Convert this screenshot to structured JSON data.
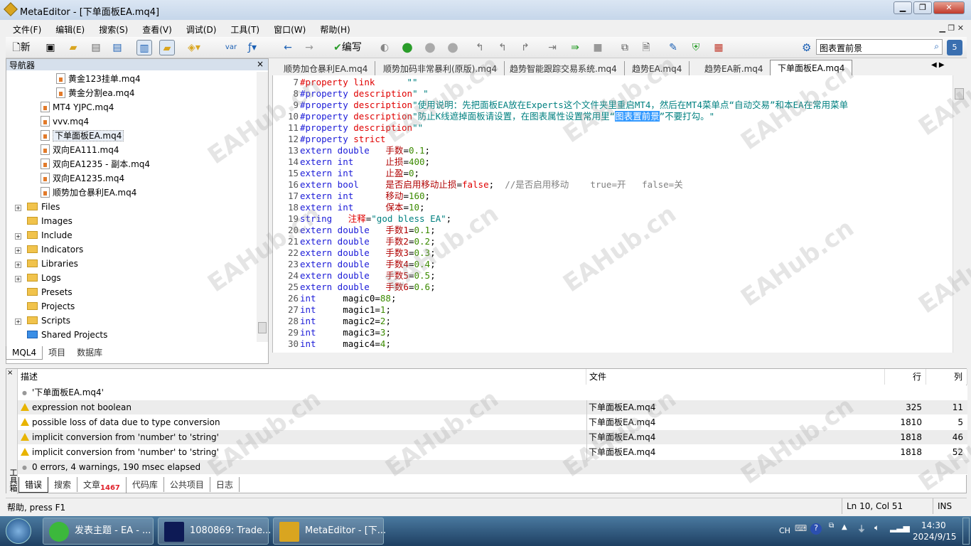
{
  "window": {
    "title": "MetaEditor - [下单面板EA.mq4]",
    "minimize": "▁",
    "restore": "❐",
    "close": "✕"
  },
  "menu": [
    "文件(F)",
    "编辑(E)",
    "搜索(S)",
    "查看(V)",
    "调试(D)",
    "工具(T)",
    "窗口(W)",
    "帮助(H)"
  ],
  "toolbar": {
    "new_label": "新",
    "compile_label": "编写",
    "var_label": "var",
    "search_value": "图表置前景"
  },
  "navigator": {
    "title": "导航器",
    "close": "×",
    "items": [
      {
        "label": "黄金123挂单.mq4",
        "type": "file",
        "indent": 3
      },
      {
        "label": "黄金分割ea.mq4",
        "type": "file",
        "indent": 3
      },
      {
        "label": "MT4 YJPC.mq4",
        "type": "file",
        "indent": 2
      },
      {
        "label": "vvv.mq4",
        "type": "file",
        "indent": 2
      },
      {
        "label": "下单面板EA.mq4",
        "type": "file",
        "indent": 2,
        "selected": true
      },
      {
        "label": "双向EA111.mq4",
        "type": "file",
        "indent": 2
      },
      {
        "label": "双向EA1235 - 副本.mq4",
        "type": "file",
        "indent": 2
      },
      {
        "label": "双向EA1235.mq4",
        "type": "file",
        "indent": 2
      },
      {
        "label": "顺势加仓暴利EA.mq4",
        "type": "file",
        "indent": 2
      },
      {
        "label": "Files",
        "type": "folder",
        "expand": true
      },
      {
        "label": "Images",
        "type": "folder",
        "expand": false
      },
      {
        "label": "Include",
        "type": "folder",
        "expand": true
      },
      {
        "label": "Indicators",
        "type": "folder",
        "expand": true
      },
      {
        "label": "Libraries",
        "type": "folder",
        "expand": true
      },
      {
        "label": "Logs",
        "type": "folder",
        "expand": true
      },
      {
        "label": "Presets",
        "type": "folder",
        "expand": false
      },
      {
        "label": "Projects",
        "type": "folder",
        "expand": false
      },
      {
        "label": "Scripts",
        "type": "folder",
        "expand": true
      },
      {
        "label": "Shared Projects",
        "type": "folder-blue",
        "expand": false
      }
    ],
    "tabs": [
      "MQL4",
      "项目",
      "数据库"
    ]
  },
  "file_tabs": [
    "顺势加仓暴利EA.mq4",
    "顺势加码非常暴利(原版).mq4",
    "趋势智能跟踪交易系统.mq4",
    "趋势EA.mq4",
    "趋势EA新.mq4",
    "下单面板EA.mq4"
  ],
  "active_file_tab": 5,
  "code": [
    {
      "n": "7",
      "t": [
        [
          "p",
          "#property "
        ],
        [
          "p",
          "link"
        ],
        [
          "s",
          "      \"\""
        ]
      ]
    },
    {
      "n": "8",
      "t": [
        [
          "k",
          "#property "
        ],
        [
          "p",
          "description"
        ],
        [
          "s",
          "\" \""
        ]
      ]
    },
    {
      "n": "9",
      "t": [
        [
          "k",
          "#property "
        ],
        [
          "p",
          "description"
        ],
        [
          "s",
          "\"使用说明：先把面板EA放在Experts这个文件夹里重启MT4，然后在MT4菜单点“自动交易”和本EA在常用菜单"
        ]
      ]
    },
    {
      "n": "10",
      "t": [
        [
          "k",
          "#property "
        ],
        [
          "p",
          "description"
        ],
        [
          "s",
          "\"防止K线遮掉面板请设置，在图表属性设置常用里“"
        ],
        [
          "sel",
          "图表置前景"
        ],
        [
          "s",
          "”不要打勾。\""
        ]
      ]
    },
    {
      "n": "11",
      "t": [
        [
          "k",
          "#property "
        ],
        [
          "p",
          "description"
        ],
        [
          "s",
          "\"\""
        ]
      ]
    },
    {
      "n": "12",
      "t": [
        [
          "k",
          "#property "
        ],
        [
          "p",
          "strict"
        ]
      ]
    },
    {
      "n": "13",
      "t": [
        [
          "k",
          "extern double   "
        ],
        [
          "v",
          "手数"
        ],
        [
          "o",
          "="
        ],
        [
          "n",
          "0.1"
        ],
        [
          "o",
          ";"
        ]
      ]
    },
    {
      "n": "14",
      "t": [
        [
          "k",
          "extern int      "
        ],
        [
          "v",
          "止损"
        ],
        [
          "o",
          "="
        ],
        [
          "n",
          "400"
        ],
        [
          "o",
          ";"
        ]
      ]
    },
    {
      "n": "15",
      "t": [
        [
          "k",
          "extern int      "
        ],
        [
          "v",
          "止盈"
        ],
        [
          "o",
          "="
        ],
        [
          "n",
          "0"
        ],
        [
          "o",
          ";"
        ]
      ]
    },
    {
      "n": "16",
      "t": [
        [
          "k",
          "extern bool     "
        ],
        [
          "v",
          "是否启用移动止损"
        ],
        [
          "o",
          "="
        ],
        [
          "f",
          "false"
        ],
        [
          "o",
          ";  "
        ],
        [
          "c",
          "//是否启用移动    true=开   false=关"
        ]
      ]
    },
    {
      "n": "17",
      "t": [
        [
          "k",
          "extern int      "
        ],
        [
          "v",
          "移动"
        ],
        [
          "o",
          "="
        ],
        [
          "n",
          "160"
        ],
        [
          "o",
          ";"
        ]
      ]
    },
    {
      "n": "18",
      "t": [
        [
          "k",
          "extern int      "
        ],
        [
          "v",
          "保本"
        ],
        [
          "o",
          "="
        ],
        [
          "n",
          "10"
        ],
        [
          "o",
          ";"
        ]
      ]
    },
    {
      "n": "19",
      "t": [
        [
          "k",
          "string   "
        ],
        [
          "p",
          "注释"
        ],
        [
          "o",
          "="
        ],
        [
          "s",
          "\"god bless EA\""
        ],
        [
          "o",
          ";"
        ]
      ]
    },
    {
      "n": "20",
      "t": [
        [
          "k",
          "extern double   "
        ],
        [
          "v",
          "手数1"
        ],
        [
          "o",
          "="
        ],
        [
          "n",
          "0.1"
        ],
        [
          "o",
          ";"
        ]
      ]
    },
    {
      "n": "21",
      "t": [
        [
          "k",
          "extern double   "
        ],
        [
          "v",
          "手数2"
        ],
        [
          "o",
          "="
        ],
        [
          "n",
          "0.2"
        ],
        [
          "o",
          ";"
        ]
      ]
    },
    {
      "n": "22",
      "t": [
        [
          "k",
          "extern double   "
        ],
        [
          "v",
          "手数3"
        ],
        [
          "o",
          "="
        ],
        [
          "n",
          "0.3"
        ],
        [
          "o",
          ";"
        ]
      ]
    },
    {
      "n": "23",
      "t": [
        [
          "k",
          "extern double   "
        ],
        [
          "v",
          "手数4"
        ],
        [
          "o",
          "="
        ],
        [
          "n",
          "0.4"
        ],
        [
          "o",
          ";"
        ]
      ]
    },
    {
      "n": "24",
      "t": [
        [
          "k",
          "extern double   "
        ],
        [
          "v",
          "手数5"
        ],
        [
          "o",
          "="
        ],
        [
          "n",
          "0.5"
        ],
        [
          "o",
          ";"
        ]
      ]
    },
    {
      "n": "25",
      "t": [
        [
          "k",
          "extern double   "
        ],
        [
          "v",
          "手数6"
        ],
        [
          "o",
          "="
        ],
        [
          "n",
          "0.6"
        ],
        [
          "o",
          ";"
        ]
      ]
    },
    {
      "n": "26",
      "t": [
        [
          "k",
          "int     "
        ],
        [
          "o",
          "magic0="
        ],
        [
          "n",
          "88"
        ],
        [
          "o",
          ";"
        ]
      ]
    },
    {
      "n": "27",
      "t": [
        [
          "k",
          "int     "
        ],
        [
          "o",
          "magic1="
        ],
        [
          "n",
          "1"
        ],
        [
          "o",
          ";"
        ]
      ]
    },
    {
      "n": "28",
      "t": [
        [
          "k",
          "int     "
        ],
        [
          "o",
          "magic2="
        ],
        [
          "n",
          "2"
        ],
        [
          "o",
          ";"
        ]
      ]
    },
    {
      "n": "29",
      "t": [
        [
          "k",
          "int     "
        ],
        [
          "o",
          "magic3="
        ],
        [
          "n",
          "3"
        ],
        [
          "o",
          ";"
        ]
      ]
    },
    {
      "n": "30",
      "t": [
        [
          "k",
          "int     "
        ],
        [
          "o",
          "magic4="
        ],
        [
          "n",
          "4"
        ],
        [
          "o",
          ";"
        ]
      ]
    }
  ],
  "errors": {
    "headers": [
      "描述",
      "文件",
      "行",
      "列"
    ],
    "file_row": "'下单面板EA.mq4'",
    "rows": [
      {
        "desc": "expression not boolean",
        "file": "下单面板EA.mq4",
        "line": "325",
        "col": "11"
      },
      {
        "desc": "possible loss of data due to type conversion",
        "file": "下单面板EA.mq4",
        "line": "1810",
        "col": "5"
      },
      {
        "desc": "implicit conversion from 'number' to 'string'",
        "file": "下单面板EA.mq4",
        "line": "1818",
        "col": "46"
      },
      {
        "desc": "implicit conversion from 'number' to 'string'",
        "file": "下单面板EA.mq4",
        "line": "1818",
        "col": "52"
      }
    ],
    "summary": "0 errors, 4 warnings, 190 msec elapsed"
  },
  "toolbox": {
    "side_label": "工具箱",
    "tabs": [
      "错误",
      "搜索",
      "文章",
      "代码库",
      "公共项目",
      "日志"
    ],
    "articles_badge": "1467"
  },
  "status": {
    "help": "帮助, press F1",
    "position": "Ln 10, Col 51",
    "mode": "INS"
  },
  "taskbar": {
    "tasks": [
      "发表主题 - EA - ...",
      "1080869: Trade...",
      "MetaEditor - [下..."
    ],
    "ime": "CH",
    "time": "14:30",
    "date": "2024/9/15"
  },
  "watermark": "EAHub.cn"
}
